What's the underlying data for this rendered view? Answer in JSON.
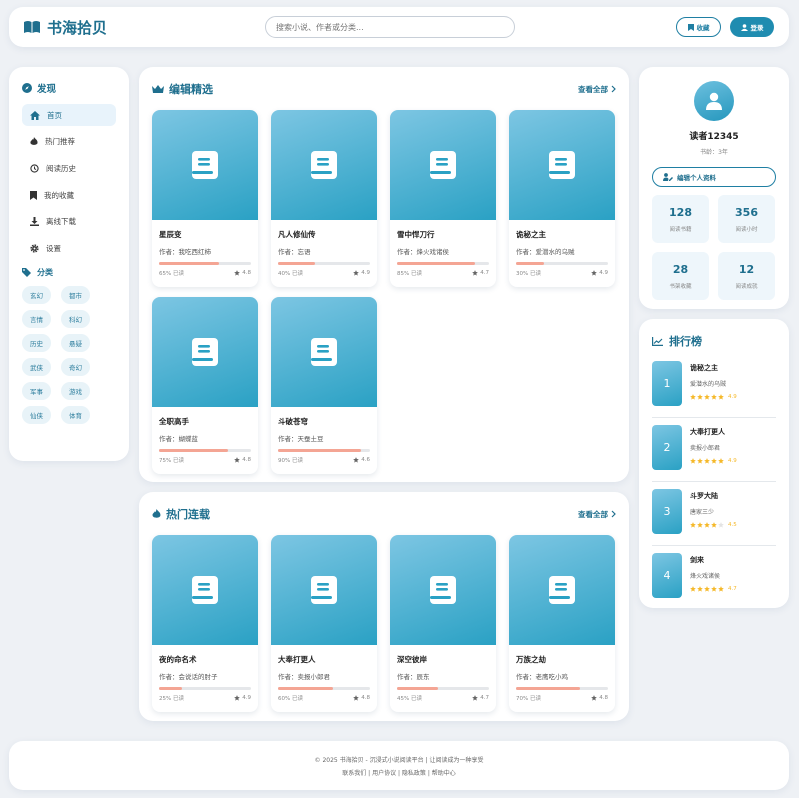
{
  "header": {
    "logo_text": "书海拾贝",
    "search_placeholder": "搜索小说、作者或分类...",
    "fav_label": "收藏",
    "login_label": "登录"
  },
  "sidebar": {
    "discover_title": "发现",
    "nav": [
      {
        "label": "首页",
        "icon": "home-icon",
        "active": true
      },
      {
        "label": "热门推荐",
        "icon": "fire-icon",
        "active": false
      },
      {
        "label": "阅读历史",
        "icon": "history-icon",
        "active": false
      },
      {
        "label": "我的收藏",
        "icon": "bookmark-icon",
        "active": false
      },
      {
        "label": "离线下载",
        "icon": "download-icon",
        "active": false
      },
      {
        "label": "设置",
        "icon": "gear-icon",
        "active": false
      }
    ],
    "category_title": "分类",
    "categories": [
      "玄幻",
      "都市",
      "言情",
      "科幻",
      "历史",
      "悬疑",
      "武侠",
      "奇幻",
      "军事",
      "游戏",
      "仙侠",
      "体育"
    ]
  },
  "editor_picks": {
    "title": "编辑精选",
    "view_all": "查看全部",
    "books": [
      {
        "title": "星辰变",
        "author": "作者：我吃西红柿",
        "progress": 65,
        "progress_text": "65% 已读",
        "rating": "4.8"
      },
      {
        "title": "凡人修仙传",
        "author": "作者：忘语",
        "progress": 40,
        "progress_text": "40% 已读",
        "rating": "4.9"
      },
      {
        "title": "雪中悍刀行",
        "author": "作者：烽火戏诸侯",
        "progress": 85,
        "progress_text": "85% 已读",
        "rating": "4.7"
      },
      {
        "title": "诡秘之主",
        "author": "作者：爱潜水的乌贼",
        "progress": 30,
        "progress_text": "30% 已读",
        "rating": "4.9"
      },
      {
        "title": "全职高手",
        "author": "作者：蝴蝶蓝",
        "progress": 75,
        "progress_text": "75% 已读",
        "rating": "4.8"
      },
      {
        "title": "斗破苍穹",
        "author": "作者：天蚕土豆",
        "progress": 90,
        "progress_text": "90% 已读",
        "rating": "4.6"
      }
    ]
  },
  "hot_serial": {
    "title": "热门连载",
    "view_all": "查看全部",
    "books": [
      {
        "title": "夜的命名术",
        "author": "作者：会说话的肘子",
        "progress": 25,
        "progress_text": "25% 已读",
        "rating": "4.9"
      },
      {
        "title": "大奉打更人",
        "author": "作者：卖报小郎君",
        "progress": 60,
        "progress_text": "60% 已读",
        "rating": "4.8"
      },
      {
        "title": "深空彼岸",
        "author": "作者：辰东",
        "progress": 45,
        "progress_text": "45% 已读",
        "rating": "4.7"
      },
      {
        "title": "万族之劫",
        "author": "作者：老鹰吃小鸡",
        "progress": 70,
        "progress_text": "70% 已读",
        "rating": "4.8"
      }
    ]
  },
  "profile": {
    "name": "读者12345",
    "age": "书龄：3年",
    "edit_label": "编辑个人资料",
    "stats": [
      {
        "value": "128",
        "label": "阅读书籍"
      },
      {
        "value": "356",
        "label": "阅读小时"
      },
      {
        "value": "28",
        "label": "书架收藏"
      },
      {
        "value": "12",
        "label": "阅读成就"
      }
    ]
  },
  "ranking": {
    "title": "排行榜",
    "items": [
      {
        "rank": "1",
        "title": "诡秘之主",
        "author": "爱潜水的乌贼",
        "stars": 5,
        "rating": "4.9"
      },
      {
        "rank": "2",
        "title": "大奉打更人",
        "author": "卖报小郎君",
        "stars": 5,
        "rating": "4.9"
      },
      {
        "rank": "3",
        "title": "斗罗大陆",
        "author": "唐家三少",
        "stars": 4,
        "rating": "4.5"
      },
      {
        "rank": "4",
        "title": "剑来",
        "author": "烽火戏诸侯",
        "stars": 4.5,
        "rating": "4.7"
      }
    ]
  },
  "footer": {
    "line1": "© 2025 书海拾贝 - 沉浸式小说阅读平台 | 让阅读成为一种享受",
    "line2": "联系我们 | 用户协议 | 隐私政策 | 帮助中心"
  },
  "colors": {
    "accent": "#1f6f8e",
    "cover_start": "#7dc6e3",
    "cover_end": "#2aa1c4",
    "progress": "#f4a594",
    "star": "#f5b92a"
  }
}
